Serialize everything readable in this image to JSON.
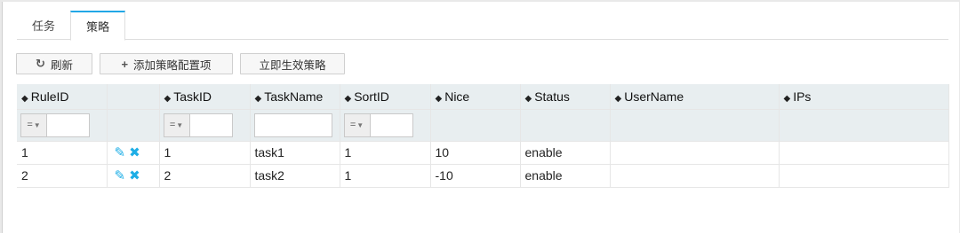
{
  "tabs": [
    {
      "label": "任务",
      "active": false
    },
    {
      "label": "策略",
      "active": true
    }
  ],
  "toolbar": {
    "refresh_label": "刷新",
    "add_label": "添加策略配置项",
    "apply_label": "立即生效策略"
  },
  "table": {
    "columns": [
      "RuleID",
      "",
      "TaskID",
      "TaskName",
      "SortID",
      "Nice",
      "Status",
      "UserName",
      "IPs"
    ],
    "filter_operator": "=",
    "rows": [
      {
        "RuleID": "1",
        "TaskID": "1",
        "TaskName": "task1",
        "SortID": "1",
        "Nice": "10",
        "Status": "enable",
        "UserName": "",
        "IPs": ""
      },
      {
        "RuleID": "2",
        "TaskID": "2",
        "TaskName": "task2",
        "SortID": "1",
        "Nice": "-10",
        "Status": "enable",
        "UserName": "",
        "IPs": ""
      }
    ]
  },
  "colors": {
    "accent": "#22a7e6",
    "action_icon": "#1eaee6",
    "header_bg": "#e8eef0"
  }
}
